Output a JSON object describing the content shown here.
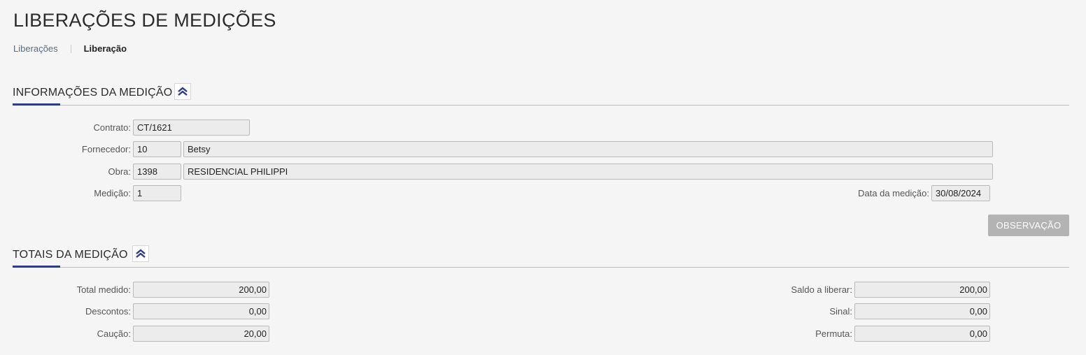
{
  "page": {
    "title": "LIBERAÇÕES DE MEDIÇÕES"
  },
  "breadcrumb": {
    "items": [
      "Liberações",
      "Liberação"
    ]
  },
  "info_section": {
    "title": "INFORMAÇÕES DA MEDIÇÃO",
    "contrato": {
      "label": "Contrato:",
      "value": "CT/1621"
    },
    "fornecedor": {
      "label": "Fornecedor:",
      "code": "10",
      "name": "Betsy"
    },
    "obra": {
      "label": "Obra:",
      "code": "1398",
      "name": "RESIDENCIAL PHILIPPI"
    },
    "medicao": {
      "label": "Medição:",
      "value": "1"
    },
    "data_medicao": {
      "label": "Data da medição:",
      "value": "30/08/2024"
    },
    "observacao_button": "OBSERVAÇÃO"
  },
  "totals_section": {
    "title": "TOTAIS DA MEDIÇÃO",
    "left": [
      {
        "label": "Total medido:",
        "value": "200,00"
      },
      {
        "label": "Descontos:",
        "value": "0,00"
      },
      {
        "label": "Caução:",
        "value": "20,00"
      }
    ],
    "right": [
      {
        "label": "Saldo a liberar:",
        "value": "200,00"
      },
      {
        "label": "Sinal:",
        "value": "0,00"
      },
      {
        "label": "Permuta:",
        "value": "0,00"
      }
    ]
  },
  "icons": {
    "collapse": "double-chevron-up-icon"
  },
  "colors": {
    "accent": "#2e3a8c",
    "button_disabled": "#b3b3b3",
    "field_bg": "#ececec"
  }
}
